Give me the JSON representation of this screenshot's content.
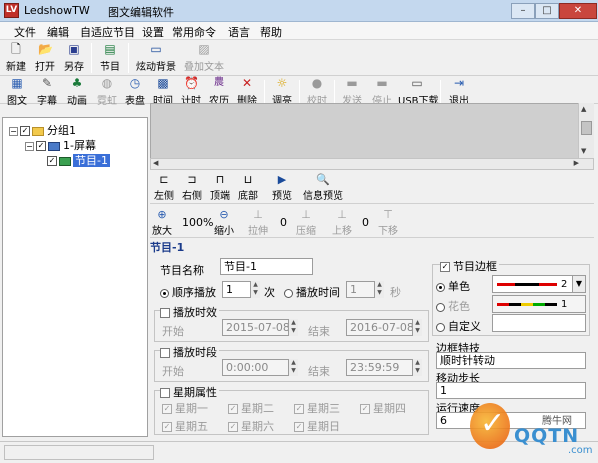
{
  "window": {
    "app_name": "LedshowTW",
    "subtitle": "图文编辑软件",
    "min": "–",
    "max": "□",
    "close": "✕"
  },
  "menu": [
    "文件",
    "编辑",
    "自适应节目",
    "设置",
    "常用命令",
    "语言",
    "帮助"
  ],
  "toolbar1": [
    "新建",
    "打开",
    "另存",
    "节目",
    "炫动背景",
    "叠加文本"
  ],
  "toolbar2": [
    "图文",
    "字幕",
    "动画",
    "霓虹",
    "表盘",
    "时间",
    "计时",
    "农历",
    "删除",
    "调亮",
    "校时",
    "发送",
    "停止",
    "USB下载",
    "退出"
  ],
  "tree": {
    "group": "分组1",
    "screen": "1-屏幕",
    "program": "节目-1"
  },
  "subtoolbar": [
    "左侧",
    "右侧",
    "顶端",
    "底部",
    "预览",
    "信息预览"
  ],
  "zoombar": {
    "zoom_in": "放大",
    "zoom_level": "100%",
    "zoom_out": "缩小",
    "stretch": "拉伸",
    "stretch_val": "0",
    "compress": "压缩",
    "up": "上移",
    "up_val": "0",
    "down": "下移"
  },
  "program": {
    "title": "节目-1",
    "name_label": "节目名称",
    "name_value": "节目-1",
    "mode_sequence": "顺序播放",
    "times_value": "1",
    "times_unit": "次",
    "mode_duration": "播放时间",
    "duration_value": "1",
    "duration_unit": "秒",
    "validity": {
      "label": "播放时效",
      "start_label": "开始",
      "start": "2015-07-08",
      "end_label": "结束",
      "end": "2016-07-08"
    },
    "period": {
      "label": "播放时段",
      "start_label": "开始",
      "start": "0:00:00",
      "end_label": "结束",
      "end": "23:59:59"
    },
    "weekday": {
      "label": "星期属性",
      "days": [
        "星期一",
        "星期二",
        "星期三",
        "星期四",
        "星期五",
        "星期六",
        "星期日"
      ]
    }
  },
  "border": {
    "label": "节目边框",
    "single": "单色",
    "single_value": "2",
    "colorful": "花色",
    "colorful_value": "1",
    "custom": "自定义",
    "effect_label": "边框特技",
    "effect_value": "顺时针转动",
    "step_label": "移动步长",
    "step_value": "1",
    "speed_label": "运行速度",
    "speed_value": "6"
  },
  "watermark": {
    "text1": "QQTN",
    "text2": "腾牛网",
    "text3": ".com"
  }
}
